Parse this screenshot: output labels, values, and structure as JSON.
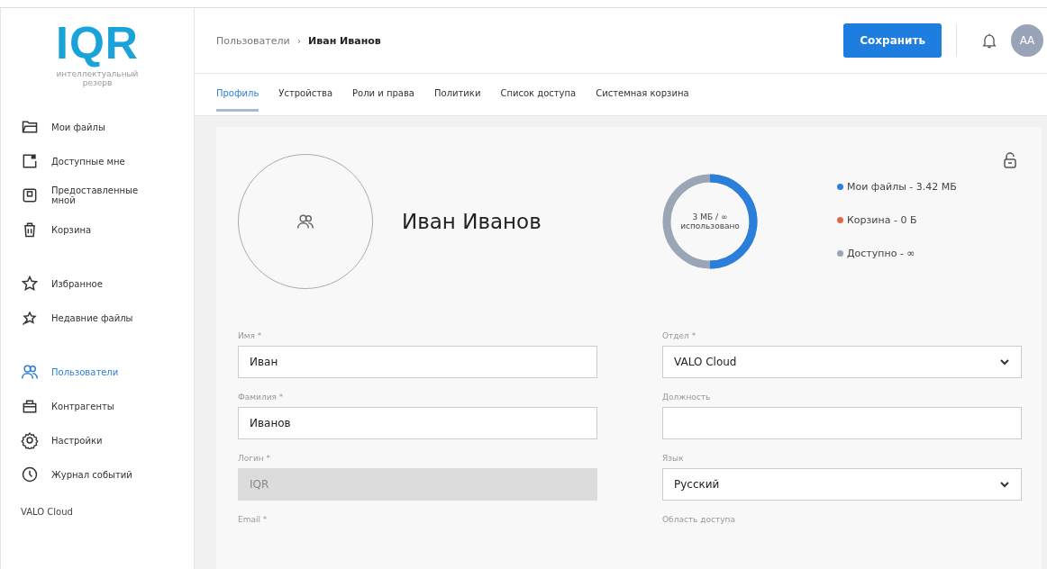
{
  "logo": {
    "mark": "IQR",
    "subtitle": "интеллектуальный резерв"
  },
  "sidebar": {
    "groups": [
      [
        {
          "label": "Мои файлы",
          "selected": false
        },
        {
          "label": "Доступные мне",
          "selected": false
        },
        {
          "label": "Предоставленные мной",
          "selected": false
        },
        {
          "label": "Корзина",
          "selected": false
        }
      ],
      [
        {
          "label": "Избранное",
          "selected": false
        },
        {
          "label": "Недавние файлы",
          "selected": false
        }
      ],
      [
        {
          "label": "Пользователи",
          "selected": true
        },
        {
          "label": "Контрагенты",
          "selected": false
        },
        {
          "label": "Настройки",
          "selected": false
        },
        {
          "label": "Журнал событий",
          "selected": false
        }
      ]
    ],
    "footer": "VALO Cloud"
  },
  "breadcrumb": [
    "Пользователи",
    "›",
    "Иван Иванов"
  ],
  "save_button": "Сохранить",
  "user_avatar": "АА",
  "tabs": [
    {
      "label": "Профиль",
      "selected": true
    },
    {
      "label": "Устройства",
      "selected": false
    },
    {
      "label": "Роли и права",
      "selected": false
    },
    {
      "label": "Политики",
      "selected": false
    },
    {
      "label": "Список доступа",
      "selected": false
    },
    {
      "label": "Системная корзина",
      "selected": false
    }
  ],
  "profile": {
    "name": "Иван Иванов",
    "storage": {
      "center": [
        "3 МБ / ∞",
        "использовано"
      ],
      "legend": [
        {
          "label": "Мои файлы - 3.42 МБ",
          "color": "#2a7fdc"
        },
        {
          "label": "Корзина - 0 Б",
          "color": "#e0684a"
        },
        {
          "label": "Доступно - ∞",
          "color": "#9aa6b6"
        }
      ]
    }
  },
  "fields": [
    [
      {
        "label": "Имя *",
        "value": "Иван",
        "kind": "text",
        "disabled": false
      },
      {
        "label": "Фамилия *",
        "value": "Иванов",
        "kind": "text",
        "disabled": false
      },
      {
        "label": "Логин *",
        "value": "IQR",
        "kind": "text",
        "disabled": true
      },
      {
        "label": "Email *",
        "kind": "label"
      }
    ],
    [
      {
        "label": "Отдел *",
        "value": "VALO Cloud",
        "kind": "select",
        "disabled": false
      },
      {
        "label": "Должность",
        "kind": "text",
        "disabled": false
      },
      {
        "label": "Язык",
        "value": "Русский",
        "kind": "select",
        "disabled": false
      },
      {
        "label": "Область доступа",
        "kind": "label"
      }
    ]
  ]
}
